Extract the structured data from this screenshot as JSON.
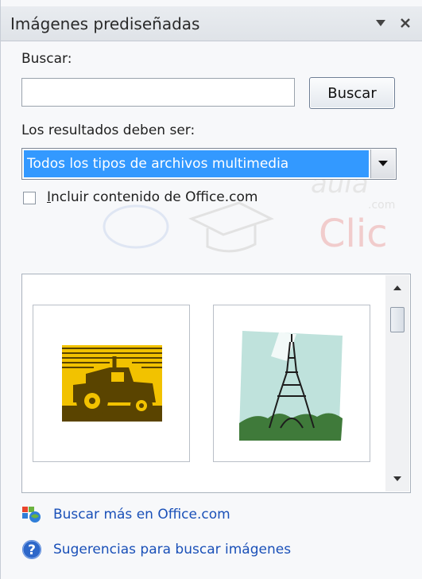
{
  "pane": {
    "title": "Imágenes prediseñadas",
    "menu_icon": "dropdown-triangle-icon",
    "close_icon": "close-icon"
  },
  "search": {
    "label": "Buscar:",
    "input_value": "",
    "button_label": "Buscar"
  },
  "results_filter": {
    "label": "Los resultados deben ser:",
    "selected": "Todos los tipos de archivos multimedia"
  },
  "office_option": {
    "label": "Incluir contenido de Office.com",
    "checked": false
  },
  "watermark": {
    "line1": "aula",
    "line2": ".com",
    "line3": "Clic"
  },
  "results": {
    "items": [
      {
        "name": "tractor clip art",
        "icon": "tractor-clipart"
      },
      {
        "name": "eiffel tower clip art",
        "icon": "eiffel-tower-clipart"
      }
    ]
  },
  "links": {
    "office_more": "Buscar más en Office.com",
    "tips": "Sugerencias para buscar imágenes"
  },
  "colors": {
    "selection": "#3399ff",
    "link": "#1a50b8",
    "tractor_yellow": "#f2c200"
  }
}
